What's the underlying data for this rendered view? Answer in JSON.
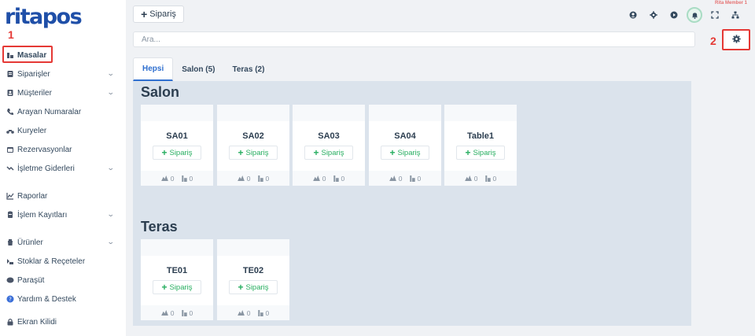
{
  "brand": {
    "logo_text": "ritapos",
    "color": "#1f4fa8"
  },
  "annotations": {
    "marker_1": "1",
    "marker_2": "2",
    "accent": "#e53935"
  },
  "sidebar": {
    "items": [
      {
        "label": "Masalar",
        "icon": "tables-icon",
        "active": true,
        "has_chevron": false
      },
      {
        "label": "Siparişler",
        "icon": "orders-icon",
        "has_chevron": true
      },
      {
        "label": "Müşteriler",
        "icon": "customers-icon",
        "has_chevron": true
      },
      {
        "label": "Arayan Numaralar",
        "icon": "phone-icon",
        "has_chevron": false
      },
      {
        "label": "Kuryeler",
        "icon": "motorcycle-icon",
        "has_chevron": false
      },
      {
        "label": "Rezervasyonlar",
        "icon": "calendar-icon",
        "has_chevron": false
      },
      {
        "label": "İşletme Giderleri",
        "icon": "expenses-icon",
        "has_chevron": true
      },
      {
        "label": "Raporlar",
        "icon": "chart-icon",
        "has_chevron": false
      },
      {
        "label": "İşlem Kayıtları",
        "icon": "logs-icon",
        "has_chevron": true
      },
      {
        "label": "Ürünler",
        "icon": "products-icon",
        "has_chevron": true
      },
      {
        "label": "Stoklar & Reçeteler",
        "icon": "stock-icon",
        "has_chevron": false
      },
      {
        "label": "Paraşüt",
        "icon": "parasut-icon",
        "has_chevron": false
      },
      {
        "label": "Yardım & Destek",
        "icon": "help-icon",
        "has_chevron": false
      },
      {
        "label": "Ekran Kilidi",
        "icon": "lock-icon",
        "has_chevron": false
      }
    ]
  },
  "topbar": {
    "new_order_label": "Sipariş",
    "member_label": "Rita Member 1",
    "icons": [
      "user-icon",
      "gear-icon",
      "play-icon",
      "bell-icon",
      "fullscreen-icon",
      "sitemap-icon"
    ]
  },
  "search": {
    "placeholder": "Ara..."
  },
  "tabs": [
    {
      "label": "Hepsi",
      "active": true
    },
    {
      "label": "Salon (5)",
      "active": false
    },
    {
      "label": "Teras (2)",
      "active": false
    }
  ],
  "sections": [
    {
      "title": "Salon",
      "tables": [
        {
          "name": "SA01",
          "order_label": "Sipariş",
          "guests": "0",
          "orders": "0"
        },
        {
          "name": "SA02",
          "order_label": "Sipariş",
          "guests": "0",
          "orders": "0"
        },
        {
          "name": "SA03",
          "order_label": "Sipariş",
          "guests": "0",
          "orders": "0"
        },
        {
          "name": "SA04",
          "order_label": "Sipariş",
          "guests": "0",
          "orders": "0"
        },
        {
          "name": "Table1",
          "order_label": "Sipariş",
          "guests": "0",
          "orders": "0"
        }
      ]
    },
    {
      "title": "Teras",
      "tables": [
        {
          "name": "TE01",
          "order_label": "Sipariş",
          "guests": "0",
          "orders": "0"
        },
        {
          "name": "TE02",
          "order_label": "Sipariş",
          "guests": "0",
          "orders": "0"
        }
      ]
    }
  ]
}
